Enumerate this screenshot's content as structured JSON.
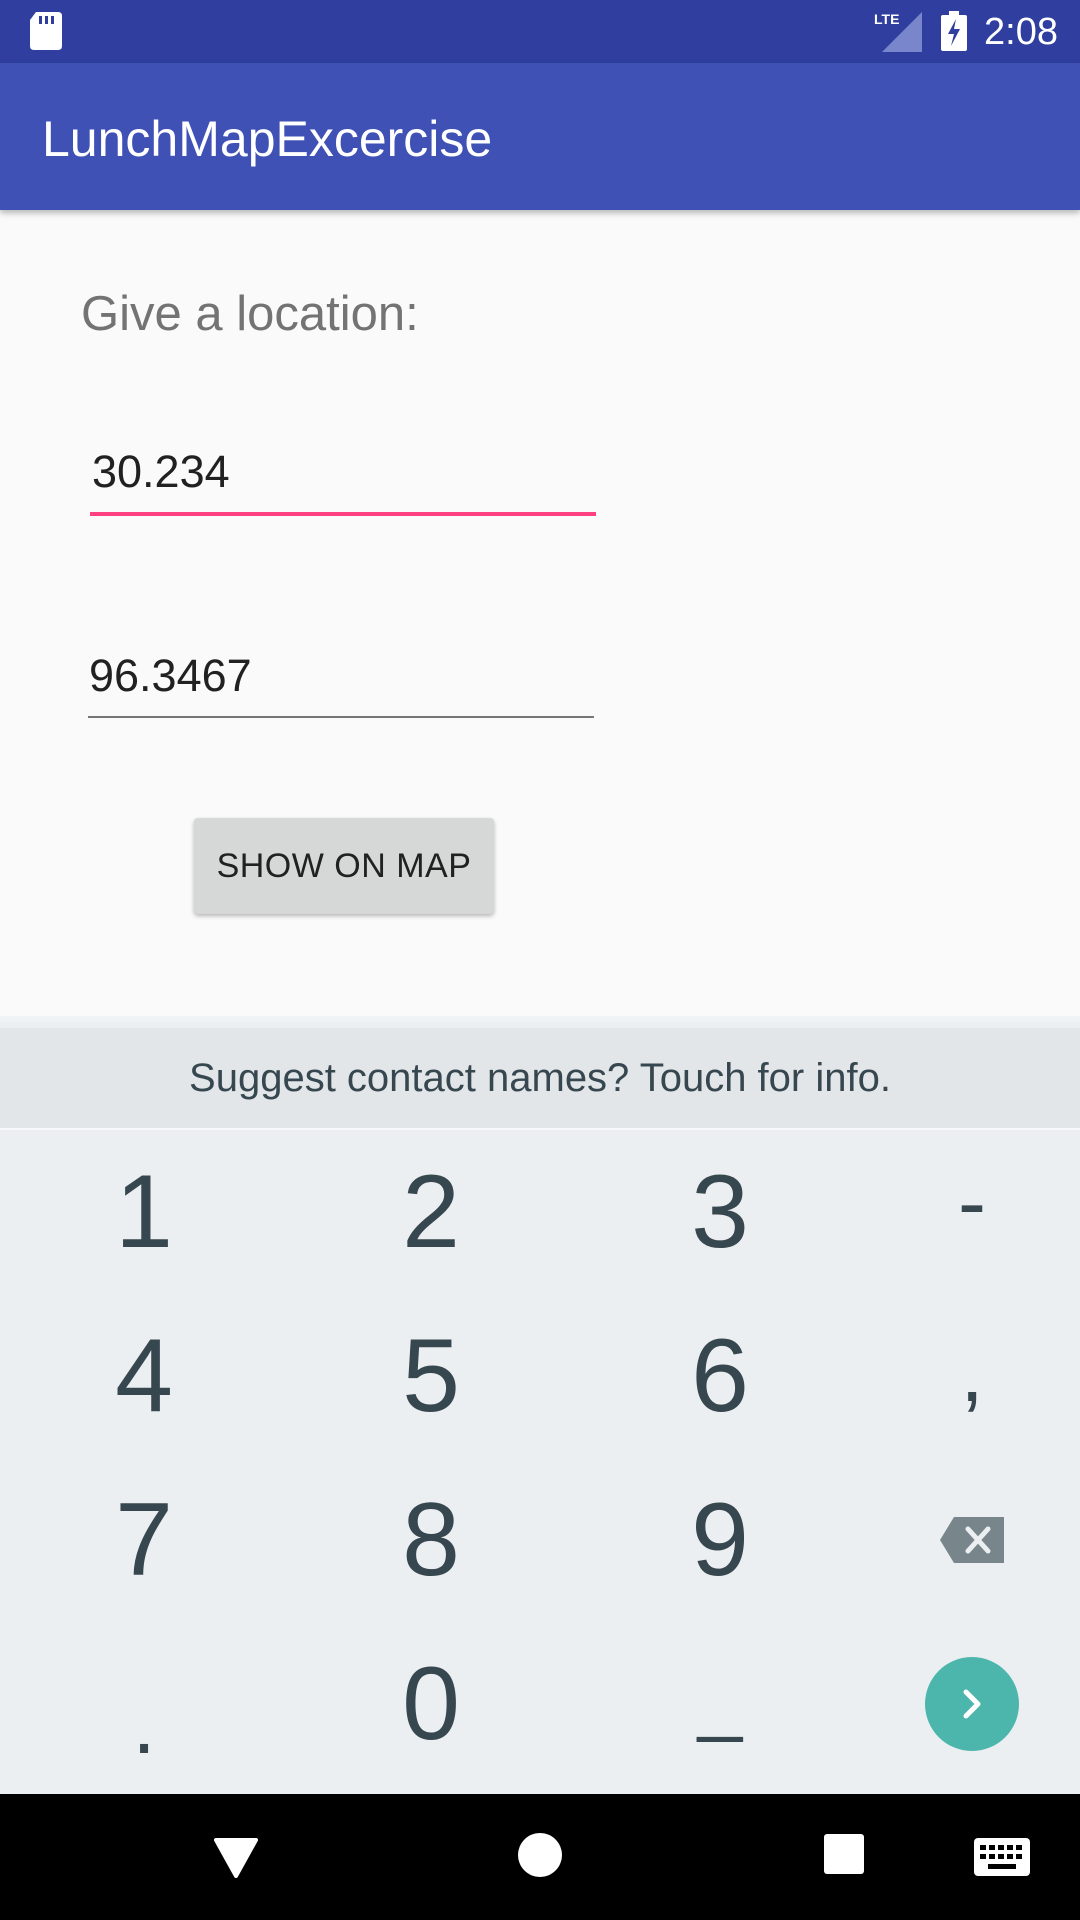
{
  "status_bar": {
    "time": "2:08",
    "network": "LTE",
    "icons": [
      "sd-card-icon",
      "lte-signal-icon",
      "battery-charging-icon"
    ],
    "background": "#303f9f"
  },
  "app_bar": {
    "title": "LunchMapExcercise",
    "background": "#3f51b5"
  },
  "form": {
    "prompt": "Give a location:",
    "latitude_value": "30.234",
    "longitude_value": "96.3467",
    "show_map_label": "SHOW ON MAP",
    "focused_underline_color": "#ff4081"
  },
  "keyboard": {
    "suggestion": "Suggest contact names? Touch for info.",
    "rows": [
      [
        "1",
        "2",
        "3",
        "-"
      ],
      [
        "4",
        "5",
        "6",
        ","
      ],
      [
        "7",
        "8",
        "9",
        "backspace-icon"
      ],
      [
        ".",
        "0",
        "_",
        "enter-icon"
      ]
    ],
    "accent": "#4db6ac"
  },
  "nav_bar": {
    "icons": [
      "back-icon",
      "home-icon",
      "recents-icon",
      "keyboard-switch-icon"
    ]
  }
}
